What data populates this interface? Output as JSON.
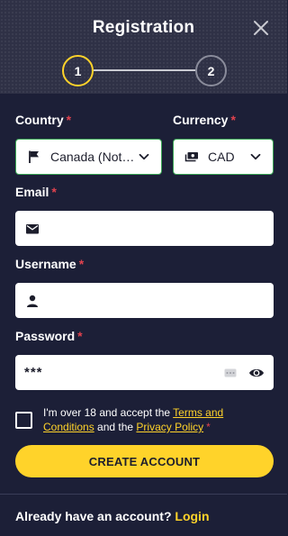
{
  "header": {
    "title": "Registration",
    "steps": [
      {
        "number": "1",
        "active": true
      },
      {
        "number": "2",
        "active": false
      }
    ]
  },
  "form": {
    "country": {
      "label": "Country",
      "required": "*",
      "value": "Canada (Not…"
    },
    "currency": {
      "label": "Currency",
      "required": "*",
      "value": "CAD"
    },
    "email": {
      "label": "Email",
      "required": "*",
      "value": ""
    },
    "username": {
      "label": "Username",
      "required": "*",
      "value": ""
    },
    "password": {
      "label": "Password",
      "required": "*",
      "value": "***"
    },
    "terms": {
      "prefix": "I'm over 18 and accept the ",
      "terms_link": "Terms and Conditions",
      "middle": " and the ",
      "privacy_link": "Privacy Policy",
      "required": "*"
    },
    "submit_label": "CREATE ACCOUNT"
  },
  "footer": {
    "prompt": "Already have an account?",
    "login_label": "Login"
  },
  "colors": {
    "accent": "#ffd32a",
    "valid_border": "#3aa655",
    "required": "#e0424e",
    "background": "#1c1f37"
  },
  "icons": {
    "close": "close-icon",
    "country": "flag-icon",
    "currency": "money-icon",
    "email": "envelope-icon",
    "username": "user-icon",
    "password_toggle": "eye-icon"
  }
}
